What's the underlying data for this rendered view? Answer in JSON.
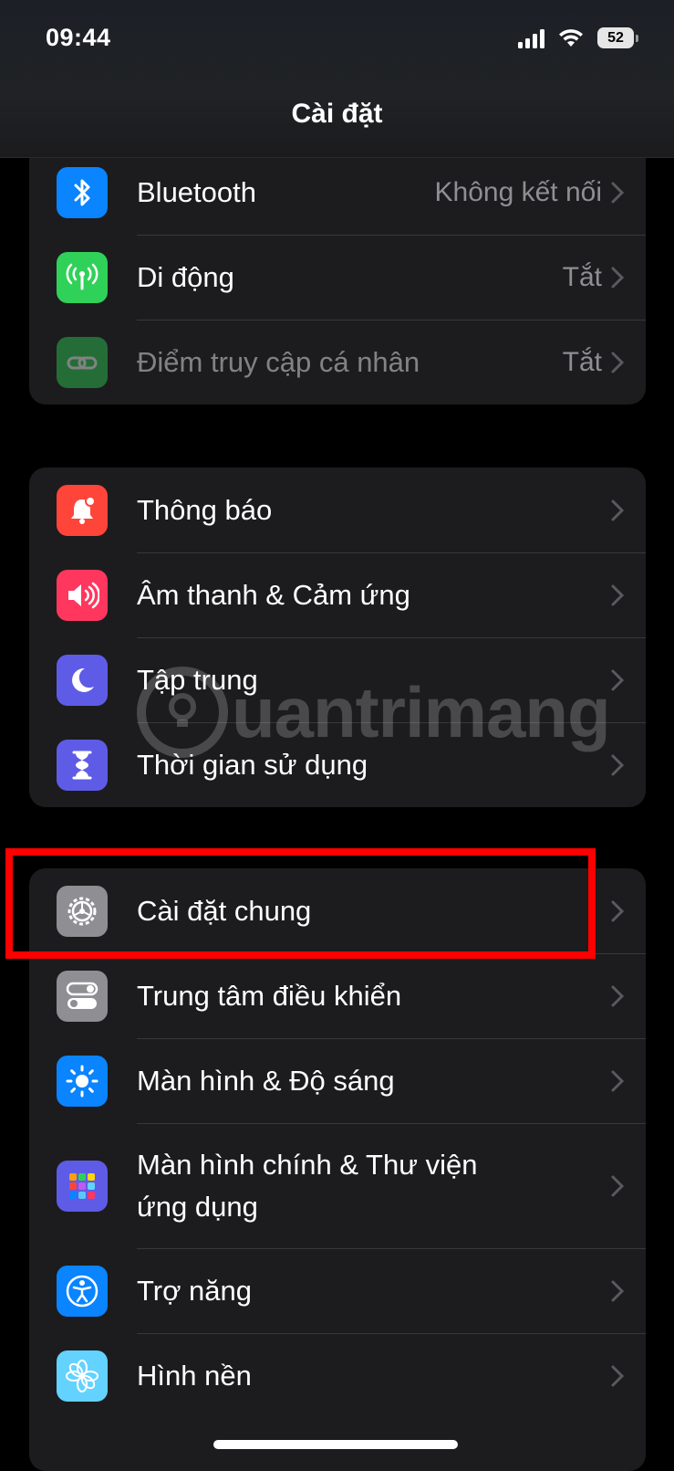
{
  "status_bar": {
    "time": "09:44",
    "battery": "52"
  },
  "nav": {
    "title": "Cài đặt"
  },
  "group1": [
    {
      "label": "Bluetooth",
      "value": "Không kết nối",
      "icon": "bluetooth-icon",
      "color": "#0a84ff"
    },
    {
      "label": "Di động",
      "value": "Tắt",
      "icon": "cellular-icon",
      "color": "#30d158"
    },
    {
      "label": "Điểm truy cập cá nhân",
      "value": "Tắt",
      "icon": "hotspot-icon",
      "color": "#30d158"
    }
  ],
  "group2": [
    {
      "label": "Thông báo",
      "icon": "notifications-icon",
      "color": "#ff453a"
    },
    {
      "label": "Âm thanh & Cảm ứng",
      "icon": "sound-icon",
      "color": "#ff375f"
    },
    {
      "label": "Tập trung",
      "icon": "focus-moon-icon",
      "color": "#5e5ce6"
    },
    {
      "label": "Thời gian sử dụng",
      "icon": "screen-time-icon",
      "color": "#5e5ce6"
    }
  ],
  "group3": [
    {
      "label": "Cài đặt chung",
      "icon": "gear-icon",
      "color": "#8e8e93"
    },
    {
      "label": "Trung tâm điều khiển",
      "icon": "control-center-icon",
      "color": "#8e8e93"
    },
    {
      "label": "Màn hình & Độ sáng",
      "icon": "brightness-icon",
      "color": "#0a84ff"
    },
    {
      "label": "Màn hình chính & Thư viện ứng dụng",
      "icon": "home-screen-icon",
      "color": "#5e5ce6"
    },
    {
      "label": "Trợ năng",
      "icon": "accessibility-icon",
      "color": "#0a84ff"
    },
    {
      "label": "Hình nền",
      "icon": "wallpaper-icon",
      "color": "#64d2ff"
    }
  ],
  "watermark": {
    "text": "uantrimang"
  }
}
